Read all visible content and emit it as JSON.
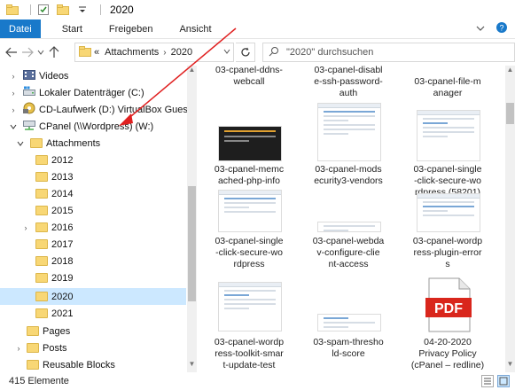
{
  "window": {
    "title": "2020"
  },
  "ribbon": {
    "tabs": [
      "Datei",
      "Start",
      "Freigeben",
      "Ansicht"
    ]
  },
  "address": {
    "overflow": "«",
    "crumbs": [
      "Attachments",
      "2020"
    ]
  },
  "search": {
    "placeholder": "\"2020\" durchsuchen"
  },
  "nav": {
    "items": [
      {
        "label": "Videos",
        "icon": "videos-icon"
      },
      {
        "label": "Lokaler Datenträger (C:)",
        "icon": "drive-icon"
      },
      {
        "label": "CD-Laufwerk (D:) VirtualBox Guest Addit",
        "icon": "cd-drive-icon"
      },
      {
        "label": "CPanel (\\\\Wordpress) (W:)",
        "icon": "network-drive-icon"
      },
      {
        "label": "Attachments",
        "icon": "folder-icon"
      },
      {
        "label": "2012",
        "icon": "folder-icon"
      },
      {
        "label": "2013",
        "icon": "folder-icon"
      },
      {
        "label": "2014",
        "icon": "folder-icon"
      },
      {
        "label": "2015",
        "icon": "folder-icon"
      },
      {
        "label": "2016",
        "icon": "folder-icon"
      },
      {
        "label": "2017",
        "icon": "folder-icon"
      },
      {
        "label": "2018",
        "icon": "folder-icon"
      },
      {
        "label": "2019",
        "icon": "folder-icon"
      },
      {
        "label": "2020",
        "icon": "folder-icon"
      },
      {
        "label": "2021",
        "icon": "folder-icon"
      },
      {
        "label": "Pages",
        "icon": "folder-icon"
      },
      {
        "label": "Posts",
        "icon": "folder-icon"
      },
      {
        "label": "Reusable Blocks",
        "icon": "folder-icon"
      }
    ]
  },
  "files": [
    {
      "name": "03-cpanel-ddns-\nwebcall"
    },
    {
      "name": "03-cpanel-disabl\ne-ssh-password-\nauth"
    },
    {
      "name": "03-cpanel-file-m\nanager"
    },
    {
      "name": "03-cpanel-memc\nached-php-info"
    },
    {
      "name": "03-cpanel-mods\necurity3-vendors"
    },
    {
      "name": "03-cpanel-single\n-click-secure-wo\nrdpress (58201)"
    },
    {
      "name": "03-cpanel-single\n-click-secure-wo\nrdpress"
    },
    {
      "name": "03-cpanel-webda\nv-configure-clie\nnt-access"
    },
    {
      "name": "03-cpanel-wordp\nress-plugin-error\ns"
    },
    {
      "name": "03-cpanel-wordp\nress-toolkit-smar\nt-update-test"
    },
    {
      "name": "03-spam-thresho\nld-score"
    },
    {
      "name": "04-20-2020\nPrivacy Policy\n(cPanel – redline)"
    }
  ],
  "pdf_label": "PDF",
  "status": {
    "count": "415 Elemente"
  },
  "colors": {
    "file_tab": "#1979ca",
    "selection": "#cce8ff",
    "folder": "#f8d775",
    "annotation_arrow": "#e02020",
    "pdf_red": "#d9261c"
  }
}
